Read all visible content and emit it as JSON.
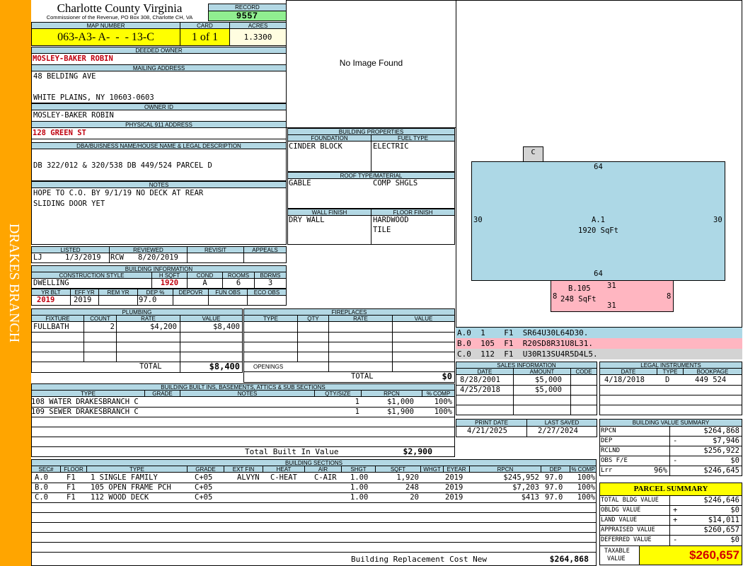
{
  "side_label": "DRAKES BRANCH",
  "header": {
    "county": "Charlotte County Virginia",
    "office": "Commissioner of the Revenue, PO Box 308, Charlotte CH, VA"
  },
  "record": {
    "label": "RECORD",
    "value": "9557"
  },
  "map": {
    "map_label": "MAP NUMBER",
    "map_number": "063-A3- A-  -  - 13-C",
    "card_label": "CARD",
    "card": "1 of 1",
    "acres_label": "ACRES",
    "acres": "1.3300"
  },
  "owner": {
    "deeded_label": "DEEDED OWNER",
    "deeded": "MOSLEY-BAKER ROBIN",
    "mailing_label": "MAILING ADDRESS",
    "address1": "48 BELDING AVE",
    "address2": "WHITE PLAINS, NY 10603-0603",
    "owner_id_label": "OWNER ID",
    "owner_id": "MOSLEY-BAKER ROBIN",
    "physical_label": "PHYSICAL 911 ADDRESS",
    "physical": "128 GREEN ST"
  },
  "legal": {
    "label": "DBA/BUISNESS NAME/HOUSE NAME & LEGAL DESCRIPTION",
    "text": "DB 322/012 & 320/538 DB 449/524 PARCEL D"
  },
  "notes": {
    "label": "NOTES",
    "line1": "HOPE TO C.O. BY 9/1/19 NO DECK AT REAR",
    "line2": "SLIDING DOOR YET"
  },
  "listing": {
    "listed_label": "LISTED",
    "reviewed_label": "REVIEWED",
    "revisit_label": "REVISIT",
    "appeals_label": "APPEALS",
    "listed_by": "LJ",
    "listed_date": "1/3/2019",
    "reviewed_by": "RCW",
    "reviewed_date": "8/20/2019"
  },
  "building_info": {
    "label": "BUILDING INFORMATION",
    "construction_label": "CONSTRUCTION STYLE",
    "hsqft_label": "H SQFT",
    "cond_label": "COND",
    "rooms_label": "ROOMS",
    "bdrms_label": "BDRMS",
    "construction": "DWELLING",
    "hsqft": "1920",
    "cond": "A",
    "rooms": "6",
    "bdrms": "3",
    "yrblt_label": "YR BLT",
    "effyr_label": "EFF YR",
    "remyr_label": "REM YR",
    "dep_label": "DEP %",
    "depovr_label": "DEPOVR",
    "funobs_label": "FUN OBS",
    "ecoobs_label": "ECO OBS",
    "yrblt": "2019",
    "effyr": "2019",
    "dep": "97.0"
  },
  "plumbing": {
    "label": "PLUMBING",
    "col_fixture": "FIXTURE",
    "col_count": "COUNT",
    "col_rate": "RATE",
    "col_value": "VALUE",
    "fixture": "FULLBATH",
    "count": "2",
    "rate": "$4,200",
    "value": "$8,400",
    "total_label": "TOTAL",
    "total": "$8,400"
  },
  "fireplaces": {
    "label": "FIREPLACES",
    "col_type": "TYPE",
    "col_qty": "QTY",
    "col_rate": "RATE",
    "col_value": "VALUE",
    "openings_label": "OPENINGS",
    "total_label": "TOTAL",
    "total": "$0"
  },
  "image": {
    "text": "No Image Found"
  },
  "building_properties": {
    "label": "BUILDING PROPERTIES",
    "foundation_label": "FOUNDATION",
    "fuel_label": "FUEL TYPE",
    "foundation": "CINDER BLOCK",
    "fuel": "ELECTRIC",
    "roof_label": "ROOF TYPE/MATERIAL",
    "roof_type": "GABLE",
    "roof_material": "COMP SHGLS",
    "wall_label": "WALL FINISH",
    "floor_label": "FLOOR FINISH",
    "wall": "DRY WALL",
    "floor1": "HARDWOOD",
    "floor2": "TILE"
  },
  "sketch": {
    "c_label": "C",
    "a_top": "64",
    "a_bottom": "64",
    "a_left": "30",
    "a_right": "30",
    "a_name": "A.1",
    "a_area": "1920 SqFt",
    "b_name": "B.105",
    "b_area": "248 SqFt",
    "b_top": "31",
    "b_bottom": "31",
    "b_left": "8",
    "b_right": "8",
    "colors": {
      "a": "#add8e6",
      "b": "#ffb6c1",
      "c": "#d3d3d3"
    }
  },
  "sketch_lines": [
    {
      "line": "A.0  1    F1  SR64U30L64D30."
    },
    {
      "line": "B.0  105  F1  R20SD8R31U8L31."
    },
    {
      "line": "C.0  112  F1  U30R13SU4R5D4L5."
    }
  ],
  "sales": {
    "label": "SALES INFORMATION",
    "col_date": "DATE",
    "col_amount": "AMOUNT",
    "col_code": "CODE",
    "rows": [
      {
        "date": "8/28/2001",
        "amount": "$5,000",
        "code": ""
      },
      {
        "date": "4/25/2018",
        "amount": "$5,000",
        "code": ""
      }
    ]
  },
  "legal_instruments": {
    "label": "LEGAL INSTRUMENTS",
    "col_date": "DATE",
    "col_type": "TYPE",
    "col_bookpage": "BOOKPAGE",
    "rows": [
      {
        "date": "4/18/2018",
        "type": "D",
        "bookpage": "449 524"
      }
    ]
  },
  "print": {
    "print_label": "PRINT DATE",
    "saved_label": "LAST SAVED",
    "print_date": "4/21/2025",
    "saved_date": "2/27/2024"
  },
  "value_summary": {
    "label": "BUILDING VALUE SUMMARY",
    "rows": [
      {
        "label": "RPCN",
        "sign": "",
        "value": "$264,868"
      },
      {
        "label": "DEP",
        "sign": "-",
        "value": "$7,946"
      },
      {
        "label": "RCLND",
        "sign": "",
        "value": "$256,922"
      },
      {
        "label": "OBS F/E",
        "sign": "-",
        "value": "$0"
      },
      {
        "label": "Lrr",
        "sign": "96%",
        "value": "$246,645"
      }
    ]
  },
  "parcel_summary": {
    "label": "PARCEL SUMMARY",
    "rows": [
      {
        "label": "TOTAL BLDG VALUE",
        "sign": "",
        "value": "$246,646"
      },
      {
        "label": "OBLDG VALUE",
        "sign": "+",
        "value": "$0"
      },
      {
        "label": "LAND VALUE",
        "sign": "+",
        "value": "$14,011"
      },
      {
        "label": "APPRAISED VALUE",
        "sign": "",
        "value": "$260,657"
      },
      {
        "label": "DEFERRED VALUE",
        "sign": "-",
        "value": "$0"
      }
    ],
    "taxable_label1": "TAXABLE",
    "taxable_label2": "VALUE",
    "taxable": "$260,657"
  },
  "builtins": {
    "label": "BUILDING BUILT INS, BASEMENTS, ATTICS & SUB SECTIONS",
    "col_type": "TYPE",
    "col_grade": "GRADE",
    "col_notes": "NOTES",
    "col_qty": "QTY/SIZE",
    "col_rpcn": "RPCN",
    "col_comp": "% COMP",
    "rows": [
      {
        "type": "108 WATER DRAKESBRANCH C",
        "qty": "1",
        "rpcn": "$1,000",
        "comp": "100%"
      },
      {
        "type": "109 SEWER DRAKESBRANCH C",
        "qty": "1",
        "rpcn": "$1,900",
        "comp": "100%"
      }
    ],
    "total_label": "Total Built In Value",
    "total": "$2,900"
  },
  "sections": {
    "label": "BUILDING SECTIONS",
    "cols": {
      "sec": "SEC#",
      "floor": "FLOOR",
      "type": "TYPE",
      "grade": "GRADE",
      "extfin": "EXT FIN",
      "heat": "HEAT",
      "air": "AIR",
      "shgt": "SHGT",
      "sqft": "SQFT",
      "wght": "WHGT",
      "eyear": "EYEAR",
      "rpcn": "RPCN",
      "dep": "DEP",
      "comp": "% COMP"
    },
    "rows": [
      {
        "sec": "A.0",
        "floor": "F1",
        "type": "1 SINGLE FAMILY",
        "grade": "C+05",
        "extfin": "ALVYN",
        "heat": "C-HEAT",
        "air": "C-AIR",
        "shgt": "1.00",
        "sqft": "1,920",
        "eyear": "2019",
        "rpcn": "$245,952",
        "dep": "97.0",
        "comp": "100%"
      },
      {
        "sec": "B.0",
        "floor": "F1",
        "type": "105 OPEN FRAME PCH",
        "grade": "C+05",
        "extfin": "",
        "heat": "",
        "air": "",
        "shgt": "1.00",
        "sqft": "248",
        "eyear": "2019",
        "rpcn": "$7,203",
        "dep": "97.0",
        "comp": "100%"
      },
      {
        "sec": "C.0",
        "floor": "F1",
        "type": "112 WOOD DECK",
        "grade": "C+05",
        "extfin": "",
        "heat": "",
        "air": "",
        "shgt": "1.00",
        "sqft": "20",
        "eyear": "2019",
        "rpcn": "$413",
        "dep": "97.0",
        "comp": "100%"
      }
    ],
    "total_label": "Building Replacement Cost New",
    "total": "$264,868"
  }
}
